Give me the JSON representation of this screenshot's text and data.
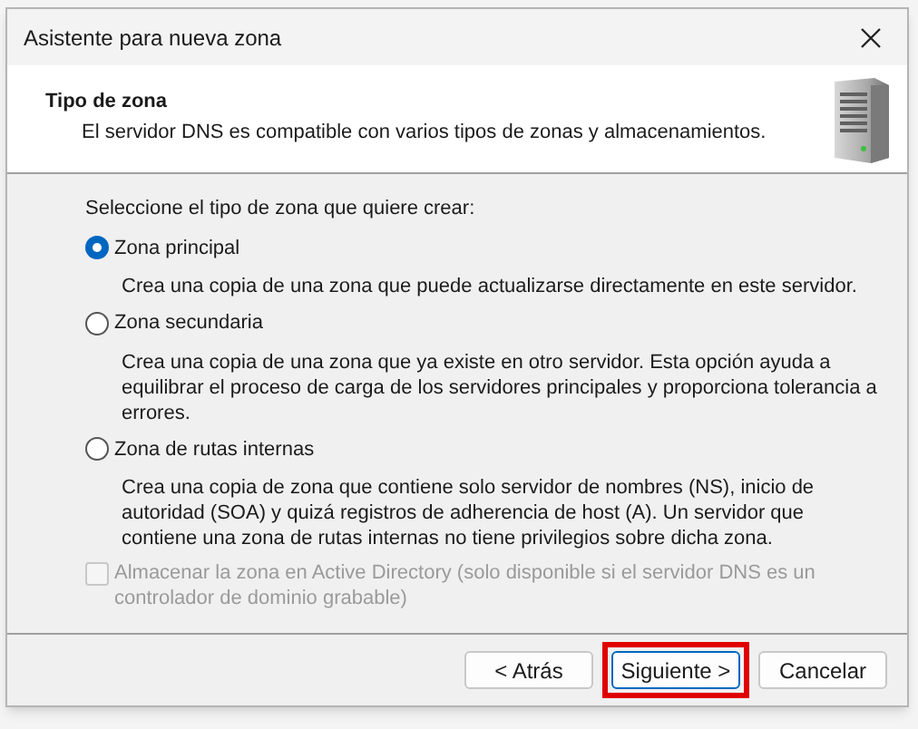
{
  "dialog": {
    "title": "Asistente para nueva zona",
    "header": {
      "title": "Tipo de zona",
      "subtitle": "El servidor DNS es compatible con varios tipos de zonas y almacenamientos."
    },
    "prompt": "Seleccione el tipo de zona que quiere crear:",
    "options": [
      {
        "label": "Zona principal",
        "selected": true,
        "description": "Crea una copia de una zona que puede actualizarse directamente en este servidor."
      },
      {
        "label": "Zona secundaria",
        "selected": false,
        "description": "Crea una copia de una zona que ya existe en otro servidor. Esta opción ayuda a equilibrar el proceso de carga de los servidores principales y proporciona tolerancia a errores."
      },
      {
        "label": "Zona de rutas internas",
        "selected": false,
        "description": "Crea una copia de zona que contiene solo servidor de nombres (NS), inicio de autoridad (SOA) y quizá registros de adherencia de host (A). Un servidor que contiene una zona de rutas internas no tiene privilegios sobre dicha zona."
      }
    ],
    "store_in_ad": {
      "label": "Almacenar la zona en Active Directory (solo disponible si el servidor DNS es un controlador de dominio grabable)",
      "checked": false,
      "disabled": true
    },
    "buttons": [
      {
        "label": "< Atrás",
        "highlighted": false
      },
      {
        "label": "Siguiente >",
        "highlighted": true
      },
      {
        "label": "Cancelar",
        "highlighted": false
      }
    ]
  }
}
